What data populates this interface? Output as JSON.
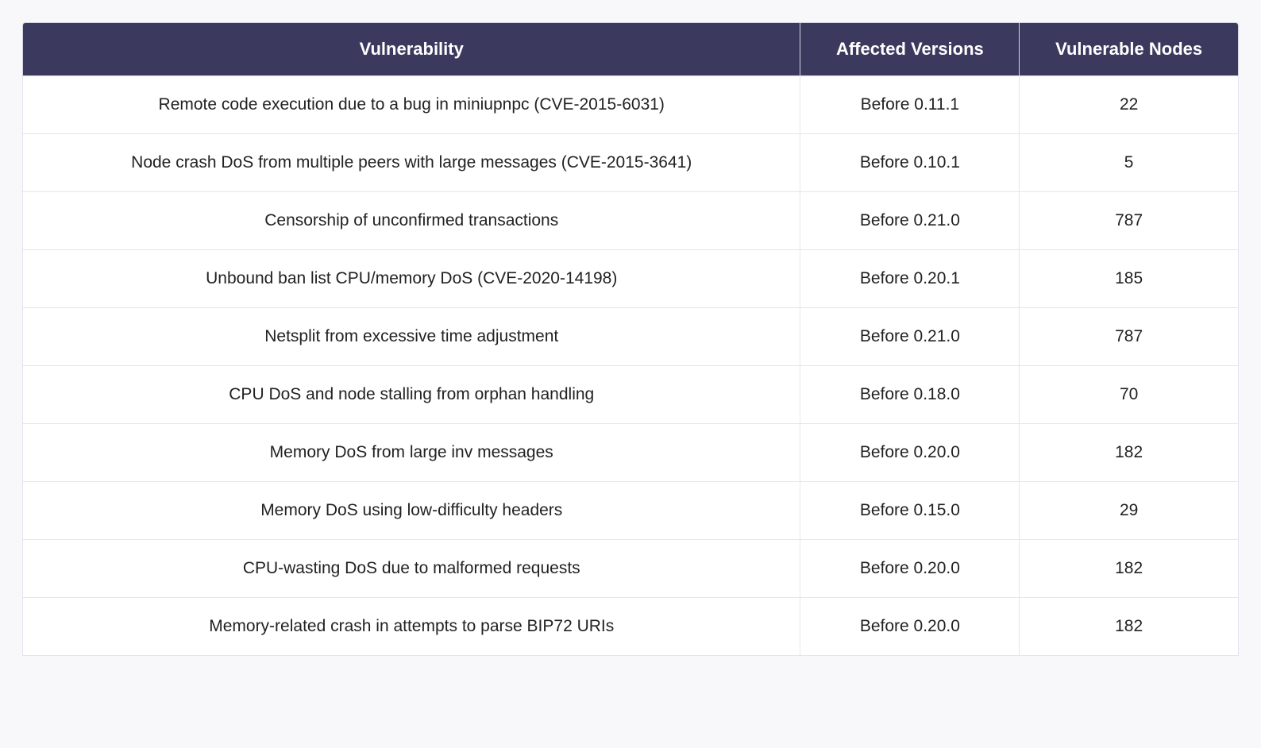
{
  "table": {
    "headers": {
      "vulnerability": "Vulnerability",
      "affected_versions": "Affected Versions",
      "vulnerable_nodes": "Vulnerable Nodes"
    },
    "rows": [
      {
        "vulnerability": "Remote code execution due to a bug in miniupnpc (CVE-2015-6031)",
        "affected_versions": "Before 0.11.1",
        "vulnerable_nodes": "22"
      },
      {
        "vulnerability": "Node crash DoS from multiple peers with large messages (CVE-2015-3641)",
        "affected_versions": "Before 0.10.1",
        "vulnerable_nodes": "5"
      },
      {
        "vulnerability": "Censorship of unconfirmed transactions",
        "affected_versions": "Before 0.21.0",
        "vulnerable_nodes": "787"
      },
      {
        "vulnerability": "Unbound ban list CPU/memory DoS (CVE-2020-14198)",
        "affected_versions": "Before 0.20.1",
        "vulnerable_nodes": "185"
      },
      {
        "vulnerability": "Netsplit from excessive time adjustment",
        "affected_versions": "Before 0.21.0",
        "vulnerable_nodes": "787"
      },
      {
        "vulnerability": "CPU DoS and node stalling from orphan handling",
        "affected_versions": "Before 0.18.0",
        "vulnerable_nodes": "70"
      },
      {
        "vulnerability": "Memory DoS from large inv messages",
        "affected_versions": "Before 0.20.0",
        "vulnerable_nodes": "182"
      },
      {
        "vulnerability": "Memory DoS using low-difficulty headers",
        "affected_versions": "Before 0.15.0",
        "vulnerable_nodes": "29"
      },
      {
        "vulnerability": "CPU-wasting DoS due to malformed requests",
        "affected_versions": "Before 0.20.0",
        "vulnerable_nodes": "182"
      },
      {
        "vulnerability": "Memory-related crash in attempts to parse BIP72 URIs",
        "affected_versions": "Before 0.20.0",
        "vulnerable_nodes": "182"
      }
    ]
  }
}
